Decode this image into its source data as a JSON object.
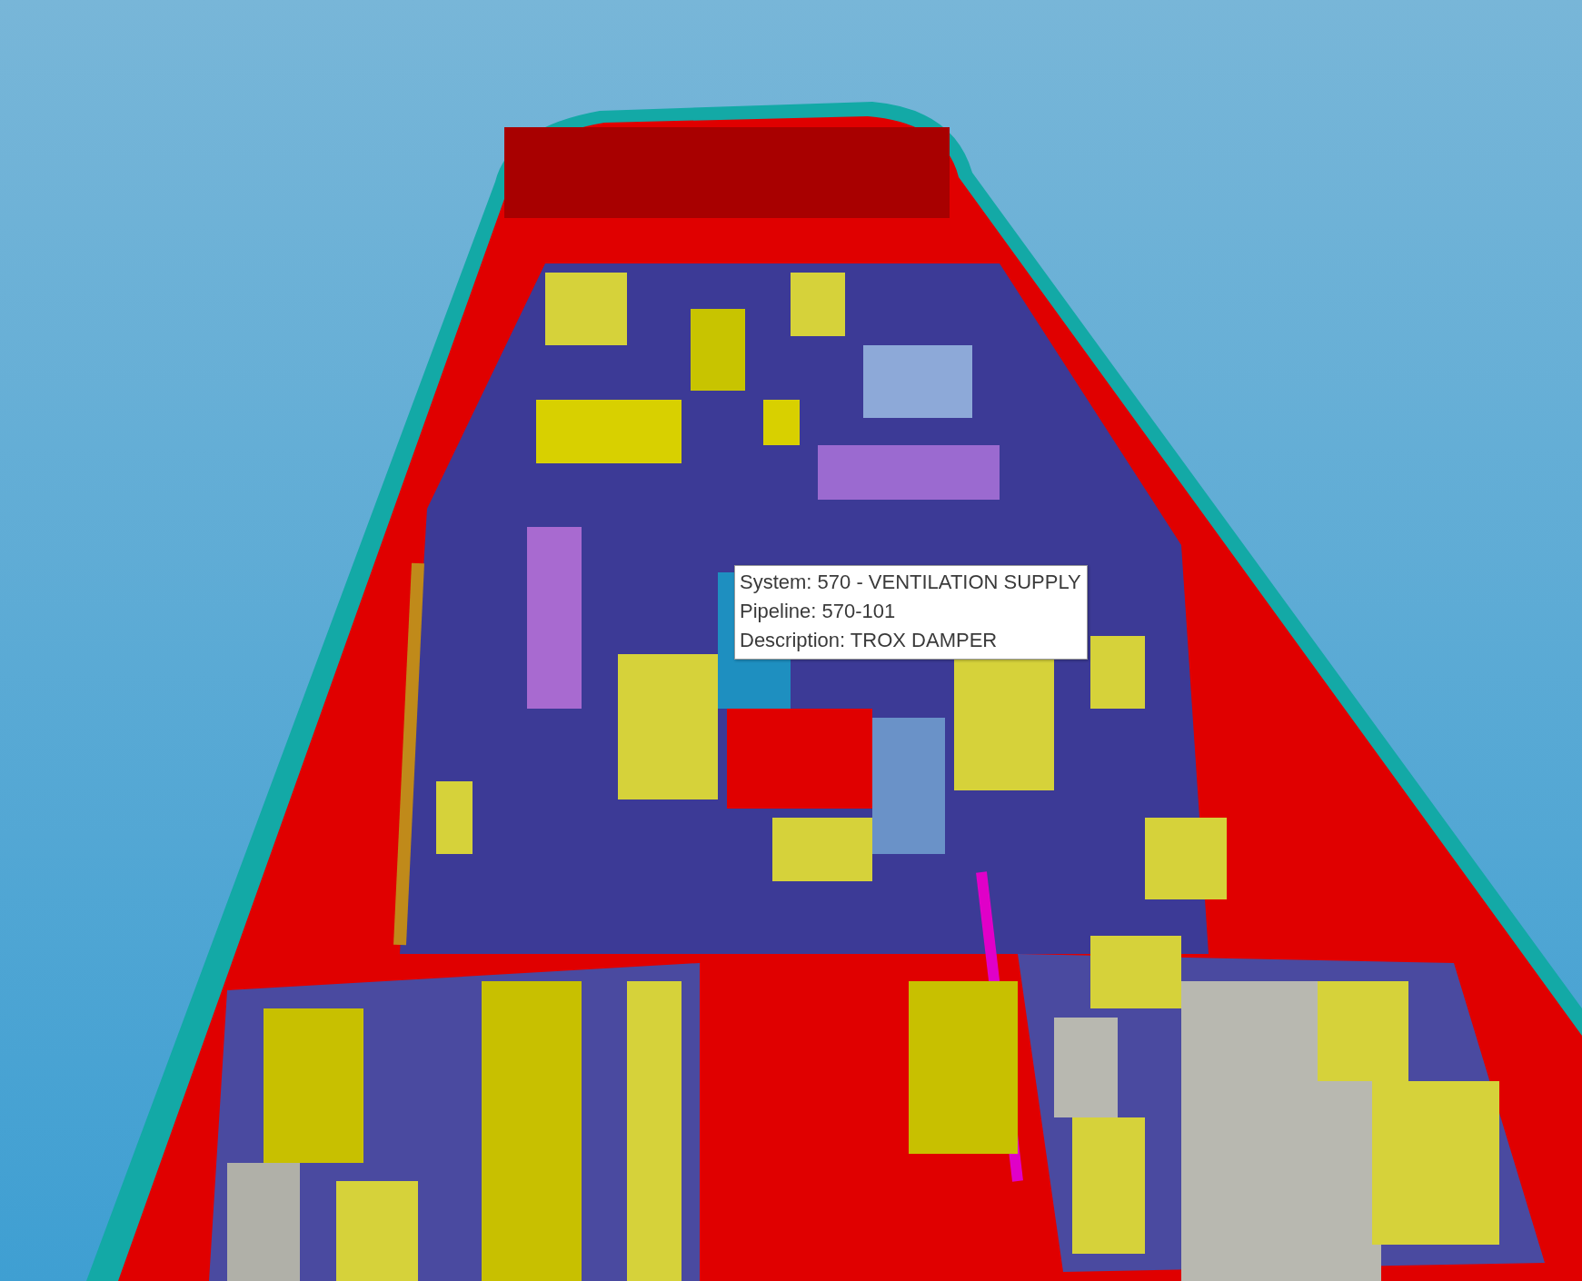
{
  "tooltip": {
    "lines": [
      {
        "text": "System: 570 - VENTILATION SUPPLY"
      },
      {
        "text": "Pipeline: 570-101"
      },
      {
        "text": "Description: TROX DAMPER"
      }
    ]
  }
}
